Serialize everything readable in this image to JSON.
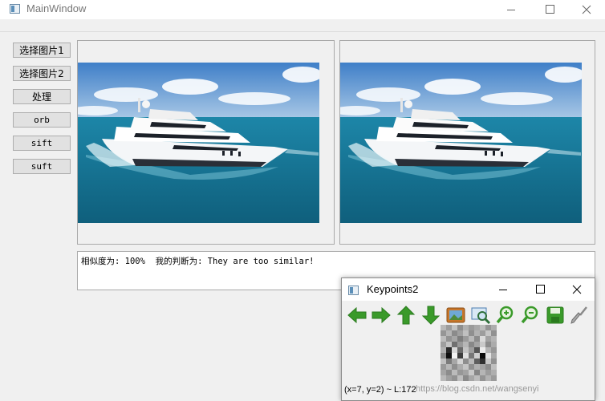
{
  "main_window": {
    "title": "MainWindow",
    "buttons": [
      {
        "label": "选择图片1"
      },
      {
        "label": "选择图片2"
      },
      {
        "label": "处理"
      },
      {
        "label": "orb"
      },
      {
        "label": "sift"
      },
      {
        "label": "suft"
      }
    ],
    "result_text": "相似度为: 100%  我的判断为: They are too similar!"
  },
  "keypoints_window": {
    "title": "Keypoints2",
    "toolbar": [
      {
        "icon": "arrow-left-icon"
      },
      {
        "icon": "arrow-right-icon"
      },
      {
        "icon": "arrow-up-icon"
      },
      {
        "icon": "arrow-down-icon"
      },
      {
        "icon": "image-icon"
      },
      {
        "icon": "zoom-fit-icon"
      },
      {
        "icon": "zoom-in-icon"
      },
      {
        "icon": "zoom-out-icon"
      },
      {
        "icon": "save-icon"
      },
      {
        "icon": "brush-icon"
      }
    ],
    "status": "(x=7, y=2) ~ L:172"
  },
  "watermark": "https://blog.csdn.net/wangsenyi",
  "colors": {
    "button_bg": "#e1e1e1",
    "toolbar_green": "#3a9a2a",
    "sea": "#1f7fa3",
    "sky": "#5d93cf"
  }
}
